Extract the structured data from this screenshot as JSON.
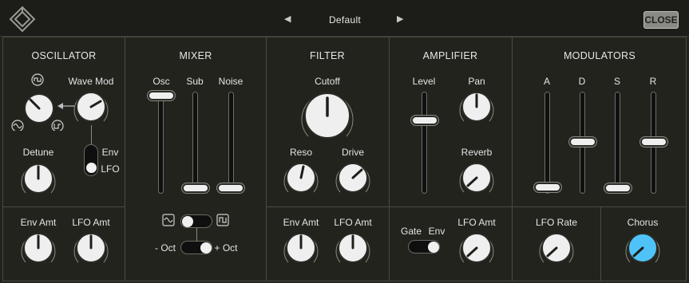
{
  "header": {
    "preset_name": "Default",
    "prev_label": "◀",
    "next_label": "▶",
    "close_label": "CLOSE"
  },
  "sections": {
    "oscillator": "OSCILLATOR",
    "mixer": "MIXER",
    "filter": "FILTER",
    "amplifier": "AMPLIFIER",
    "modulators": "MODULATORS"
  },
  "oscillator": {
    "wave_mod": "Wave Mod",
    "detune": "Detune",
    "env": "Env",
    "lfo": "LFO",
    "env_amt": "Env Amt",
    "lfo_amt": "LFO Amt"
  },
  "mixer": {
    "osc": "Osc",
    "sub": "Sub",
    "noise": "Noise",
    "oct_minus": "- Oct",
    "oct_plus": "+ Oct"
  },
  "filter": {
    "cutoff": "Cutoff",
    "reso": "Reso",
    "drive": "Drive",
    "env_amt": "Env Amt",
    "lfo_amt": "LFO Amt"
  },
  "amplifier": {
    "level": "Level",
    "pan": "Pan",
    "reverb": "Reverb",
    "gate": "Gate",
    "env": "Env",
    "lfo_amt": "LFO Amt"
  },
  "modulators": {
    "a": "A",
    "d": "D",
    "s": "S",
    "r": "R",
    "lfo_rate": "LFO Rate",
    "chorus": "Chorus"
  },
  "colors": {
    "background": "#23231e",
    "knob_face": "#efefef",
    "accent_chorus": "#4fc3f7",
    "slider_thumb": "#efefef"
  },
  "icons": {
    "logo": "diamond-logo-icon",
    "wave_square": "square-wave-icon",
    "wave_sine": "sine-wave-icon",
    "wave_saw": "saw-wave-icon"
  }
}
